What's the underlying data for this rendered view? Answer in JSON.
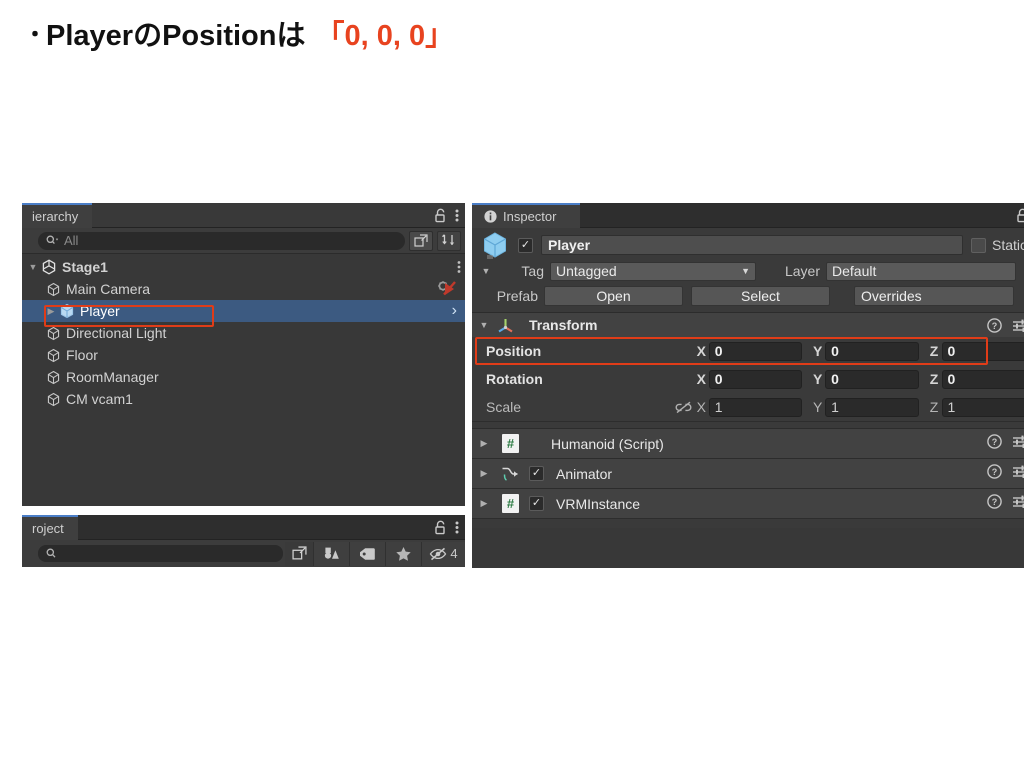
{
  "slide": {
    "bullet": "・",
    "title_main": "PlayerのPositionは",
    "title_accent": "「0, 0, 0」",
    "accent_color": "#e8431f"
  },
  "hierarchy": {
    "tab_label": "ierarchy",
    "lock_icon": "lock-icon",
    "menu_icon": "kebab-menu-icon",
    "search": {
      "placeholder": "All",
      "icon": "search-dropdown-icon"
    },
    "new_window_icon": "open-in-new-window-icon",
    "sort_icon": "alphabetical-sort-icon",
    "items": [
      {
        "label": "Stage1",
        "depth": 0,
        "arrow": "▼",
        "icon": "unity-scene-icon",
        "selected": false
      },
      {
        "label": "Main Camera",
        "depth": 1,
        "arrow": "",
        "icon": "gameobject-cube-icon",
        "selected": false,
        "badge": "prefab-broken-icon"
      },
      {
        "label": "Player",
        "depth": 1,
        "arrow": "▶",
        "icon": "prefab-cube-icon",
        "selected": true,
        "chevron": "›"
      },
      {
        "label": "Directional Light",
        "depth": 1,
        "arrow": "",
        "icon": "gameobject-cube-icon",
        "selected": false
      },
      {
        "label": "Floor",
        "depth": 1,
        "arrow": "",
        "icon": "gameobject-cube-icon",
        "selected": false
      },
      {
        "label": "RoomManager",
        "depth": 1,
        "arrow": "",
        "icon": "gameobject-cube-icon",
        "selected": false
      },
      {
        "label": "CM vcam1",
        "depth": 1,
        "arrow": "",
        "icon": "gameobject-cube-icon",
        "selected": false
      }
    ]
  },
  "project": {
    "tab_label": "roject",
    "lock_icon": "lock-icon",
    "menu_icon": "kebab-menu-icon",
    "search": {
      "placeholder": "",
      "icon": "search-icon"
    },
    "new_window_icon": "open-in-new-window-icon",
    "filter_type_icon": "filter-by-type-icon",
    "filter_label_icon": "filter-by-label-icon",
    "favorites_icon": "star-favorite-icon",
    "hidden_icon": "hidden-packages-icon",
    "hidden_count": "4"
  },
  "inspector": {
    "tab_label": "Inspector",
    "tab_icon": "info-circle-icon",
    "lock_icon": "lock-icon",
    "object_icon": "prefab-cube-icon",
    "enabled": true,
    "name_value": "Player",
    "static_label": "Static",
    "static_checked": false,
    "tag_label": "Tag",
    "tag_value": "Untagged",
    "layer_label": "Layer",
    "layer_value": "Default",
    "prefab_label": "Prefab",
    "prefab_open": "Open",
    "prefab_select": "Select",
    "prefab_overrides": "Overrides",
    "transform": {
      "title": "Transform",
      "icon": "transform-axes-icon",
      "help_icon": "help-circle-icon",
      "settings_icon": "component-settings-icon",
      "rows": [
        {
          "label": "Position",
          "x": "0",
          "y": "0",
          "z": "0",
          "dim": false,
          "link": ""
        },
        {
          "label": "Rotation",
          "x": "0",
          "y": "0",
          "z": "0",
          "dim": false,
          "link": ""
        },
        {
          "label": "Scale",
          "x": "1",
          "y": "1",
          "z": "1",
          "dim": true,
          "link": "broken-link-icon"
        }
      ],
      "highlight_row": "Position",
      "highlight_color": "#e03c18"
    },
    "components": [
      {
        "name": "Humanoid (Script)",
        "icon": "script-icon",
        "has_checkbox": false,
        "checked": false
      },
      {
        "name": "Animator",
        "icon": "animator-icon",
        "has_checkbox": true,
        "checked": true
      },
      {
        "name": "VRMInstance",
        "icon": "script-icon",
        "has_checkbox": true,
        "checked": true
      }
    ]
  }
}
